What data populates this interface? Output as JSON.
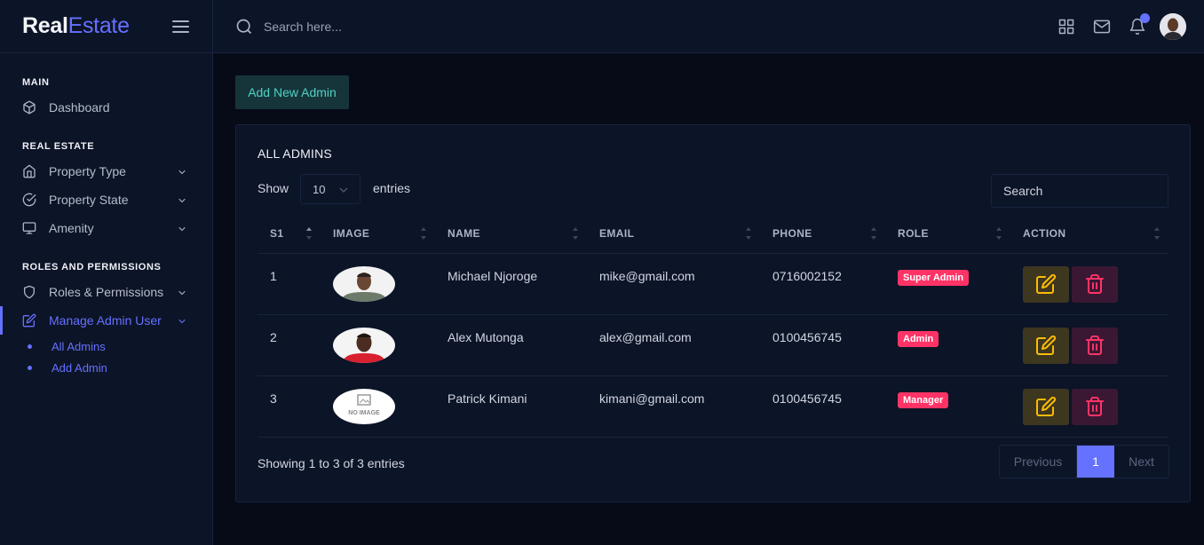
{
  "brand": {
    "part1": "Real",
    "part2": "Estate"
  },
  "search": {
    "placeholder": "Search here..."
  },
  "sidebar": {
    "categories": [
      "MAIN",
      "REAL ESTATE",
      "ROLES AND PERMISSIONS"
    ],
    "items": [
      {
        "label": "Dashboard",
        "icon": "box-icon"
      },
      {
        "label": "Property Type",
        "icon": "home-icon"
      },
      {
        "label": "Property State",
        "icon": "check-circle-icon"
      },
      {
        "label": "Amenity",
        "icon": "monitor-icon"
      },
      {
        "label": "Roles & Permissions",
        "icon": "shield-icon"
      },
      {
        "label": "Manage Admin User",
        "icon": "edit-icon"
      }
    ],
    "subitems": [
      "All Admins",
      "Add Admin"
    ]
  },
  "main": {
    "add_button": "Add New Admin",
    "card_title": "ALL ADMINS",
    "show_label": "Show",
    "entries_label": "entries",
    "page_length": "10",
    "table_search_placeholder": "Search",
    "columns": [
      "S1",
      "IMAGE",
      "NAME",
      "EMAIL",
      "PHONE",
      "ROLE",
      "ACTION"
    ],
    "rows": [
      {
        "sn": "1",
        "name": "Michael Njoroge",
        "email": "mike@gmail.com",
        "phone": "0716002152",
        "role": "Super Admin",
        "image": "photo"
      },
      {
        "sn": "2",
        "name": "Alex Mutonga",
        "email": "alex@gmail.com",
        "phone": "0100456745",
        "role": "Admin",
        "image": "photo"
      },
      {
        "sn": "3",
        "name": "Patrick Kimani",
        "email": "kimani@gmail.com",
        "phone": "0100456745",
        "role": "Manager",
        "image": "no-image"
      }
    ],
    "no_image_text": "NO IMAGE",
    "info": "Showing 1 to 3 of 3 entries",
    "pagination": {
      "previous": "Previous",
      "current": "1",
      "next": "Next"
    }
  },
  "colors": {
    "accent": "#6571ff",
    "badge": "#ff3366",
    "edit": "#fbbc06",
    "teal": "#4fd1c5"
  }
}
